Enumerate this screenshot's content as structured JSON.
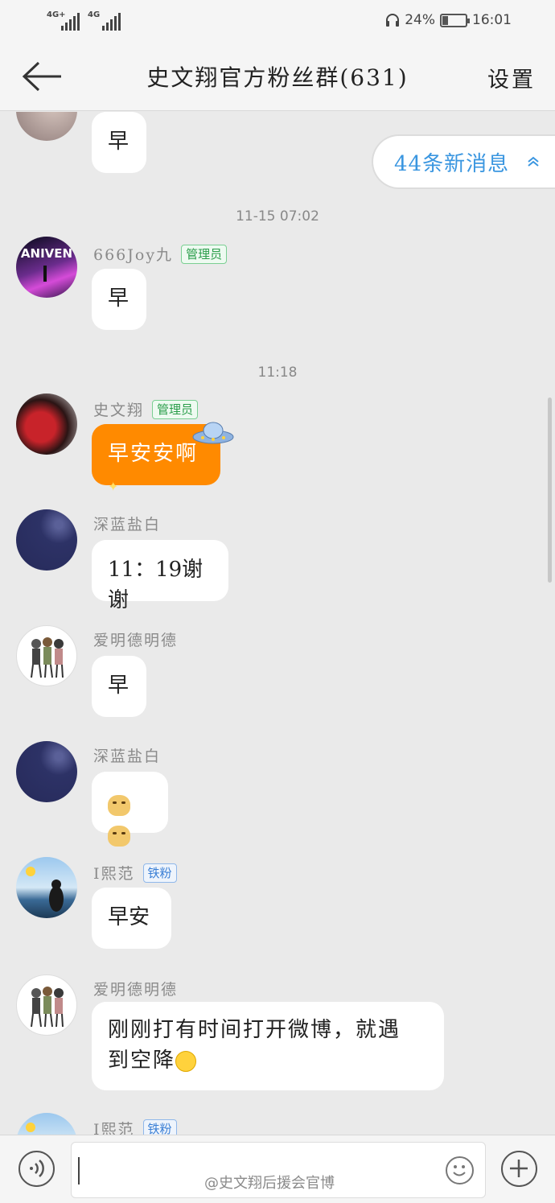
{
  "status_bar": {
    "signal1_label": "4G+",
    "signal2_label": "4G",
    "battery_percent": "24%",
    "battery_level": 0.24,
    "time": "16:01"
  },
  "nav": {
    "title": "史文翔官方粉丝群(631)",
    "settings_label": "设置"
  },
  "new_messages": {
    "label": "44条新消息"
  },
  "messages": [
    {
      "text": "早"
    },
    {
      "timestamp": "11-15 07:02"
    },
    {
      "name": "666Joy九",
      "badge": "管理员",
      "text": "早"
    },
    {
      "timestamp": "11:18"
    },
    {
      "name": "史文翔",
      "badge": "管理员",
      "text": "早安安啊"
    },
    {
      "name": "深蓝盐白",
      "text": "11：19谢谢"
    },
    {
      "name": "爱明德明德",
      "text": "早"
    },
    {
      "name": "深蓝盐白"
    },
    {
      "name": "I熙范",
      "badge": "铁粉",
      "text": "早安"
    },
    {
      "name": "爱明德明德",
      "text_line1": "刚刚打有时间打开微博，就遇",
      "text_line2": "到空降"
    },
    {
      "name": "I熙范",
      "badge": "铁粉"
    }
  ],
  "watermark": "@史文翔后援会官博",
  "colors": {
    "accent_blue": "#3a96e0",
    "admin_green": "#2a9d4a",
    "highlight_orange": "#ff8a00"
  }
}
